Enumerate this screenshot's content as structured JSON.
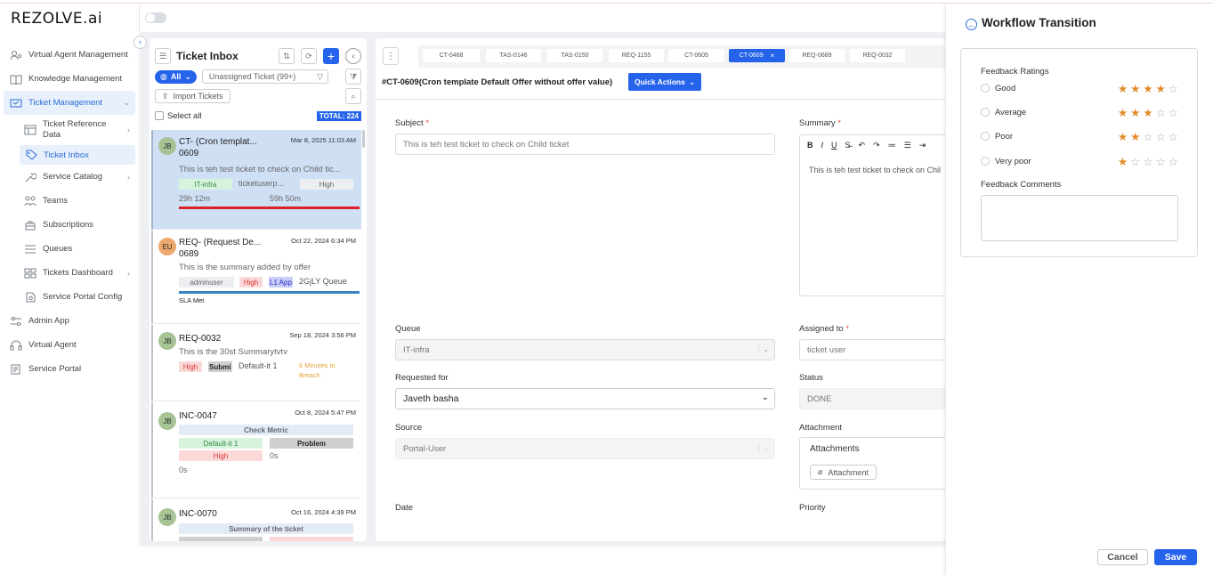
{
  "app": {
    "logo": "REZOLVE.ai"
  },
  "sidebar": {
    "items": [
      {
        "label": "Virtual Agent Management",
        "icon": "users-gear-icon"
      },
      {
        "label": "Knowledge Management",
        "icon": "book-icon"
      },
      {
        "label": "Ticket Management",
        "icon": "ticket-icon"
      },
      {
        "label": "Ticket Reference Data",
        "icon": "table-icon"
      },
      {
        "label": "Ticket Inbox",
        "icon": "tag-icon"
      },
      {
        "label": "Service Catalog",
        "icon": "wrench-icon"
      },
      {
        "label": "Teams",
        "icon": "team-icon"
      },
      {
        "label": "Subscriptions",
        "icon": "subscription-icon"
      },
      {
        "label": "Queues",
        "icon": "queue-icon"
      },
      {
        "label": "Tickets Dashboard",
        "icon": "dashboard-icon"
      },
      {
        "label": "Service Portal Config",
        "icon": "config-icon"
      },
      {
        "label": "Admin App",
        "icon": "sliders-icon"
      },
      {
        "label": "Virtual Agent",
        "icon": "headset-icon"
      },
      {
        "label": "Service Portal",
        "icon": "portal-icon"
      }
    ]
  },
  "inbox": {
    "title": "Ticket Inbox",
    "all_label": "All",
    "filter_label": "Unassigned Ticket  (99+)",
    "import_label": "Import Tickets",
    "select_all": "Select all",
    "total": "TOTAL: 224",
    "tickets": [
      {
        "avatar": "JB",
        "id": "CT-   (Cron templat...",
        "id2": "0609",
        "date": "Mar 8, 2025 11:03 AM",
        "summary": "This is teh test ticket to check on Child tic...",
        "tag1": "IT-infra",
        "tag2": "ticketuserp...",
        "tag3": "High",
        "time1": "29h 12m",
        "time2": "59h 50m"
      },
      {
        "avatar": "EU",
        "id": "REQ-   (Request De...",
        "id2": "0689",
        "date": "Oct 22, 2024 6:34 PM",
        "summary": "This is the summary added by offer",
        "tag1": "adminuser",
        "tag2": "High",
        "tag3": "L1 App",
        "tag4": "2GjLY Queue",
        "sla": "SLA Met"
      },
      {
        "avatar": "JB",
        "id": "REQ-0032",
        "date": "Sep 18, 2024 3:56 PM",
        "summary": "This is the 30st Summarytvtv",
        "tag1": "High",
        "tag2": "Submi",
        "tag3": "Default-it 1",
        "breach": "6 Minutes to Breach"
      },
      {
        "avatar": "JB",
        "id": "INC-0047",
        "date": "Oct 8, 2024 5:47 PM",
        "metric": "Check Metric",
        "tag1": "Default-it 1",
        "tag2": "Problem",
        "tag3": "High",
        "tag4": "0s",
        "time": "0s"
      },
      {
        "avatar": "JB",
        "id": "INC-0070",
        "date": "Oct 16, 2024 4:39 PM",
        "metric": "Summary of the ticket"
      }
    ]
  },
  "content": {
    "tabs": [
      "CT-0468",
      "TAS-0146",
      "TAS-0150",
      "REQ-1155",
      "CT-0605",
      "CT-0609",
      "REQ-0689",
      "REQ-0032"
    ],
    "active_tab_close": "×",
    "title": "#CT-0609(Cron template Default Offer without offer value)",
    "quick_actions": "Quick Actions",
    "subject_label": "Subject",
    "subject_value": "This is teh test ticket to check on Child ticket",
    "summary_label": "Summary",
    "summary_value": "This is teh test ticket to check on Chil",
    "queue_label": "Queue",
    "queue_value": "IT-infra",
    "assigned_label": "Assigned to",
    "assigned_value": "ticket user",
    "requested_label": "Requested for",
    "requested_value": "Javeth basha",
    "status_label": "Status",
    "status_value": "DONE",
    "source_label": "Source",
    "source_value": "Portal-User",
    "attachment_label": "Attachment",
    "attachments_title": "Attachments",
    "attachment_btn": "Attachment",
    "date_label": "Date",
    "priority_label": "Priority",
    "required_mark": "*"
  },
  "panel": {
    "title": "Workflow Transition",
    "ratings_label": "Feedback Ratings",
    "ratings": [
      {
        "label": "Good",
        "stars": 4
      },
      {
        "label": "Average",
        "stars": 3
      },
      {
        "label": "Poor",
        "stars": 2
      },
      {
        "label": "Very poor",
        "stars": 1
      }
    ],
    "comments_label": "Feedback Comments",
    "cancel": "Cancel",
    "save": "Save"
  },
  "colors": {
    "accent": "#2563eb",
    "star": "#e38b28",
    "sla_red": "#e11d2a",
    "sla_blue": "#3b82c4",
    "breach": "#e6a23c"
  }
}
